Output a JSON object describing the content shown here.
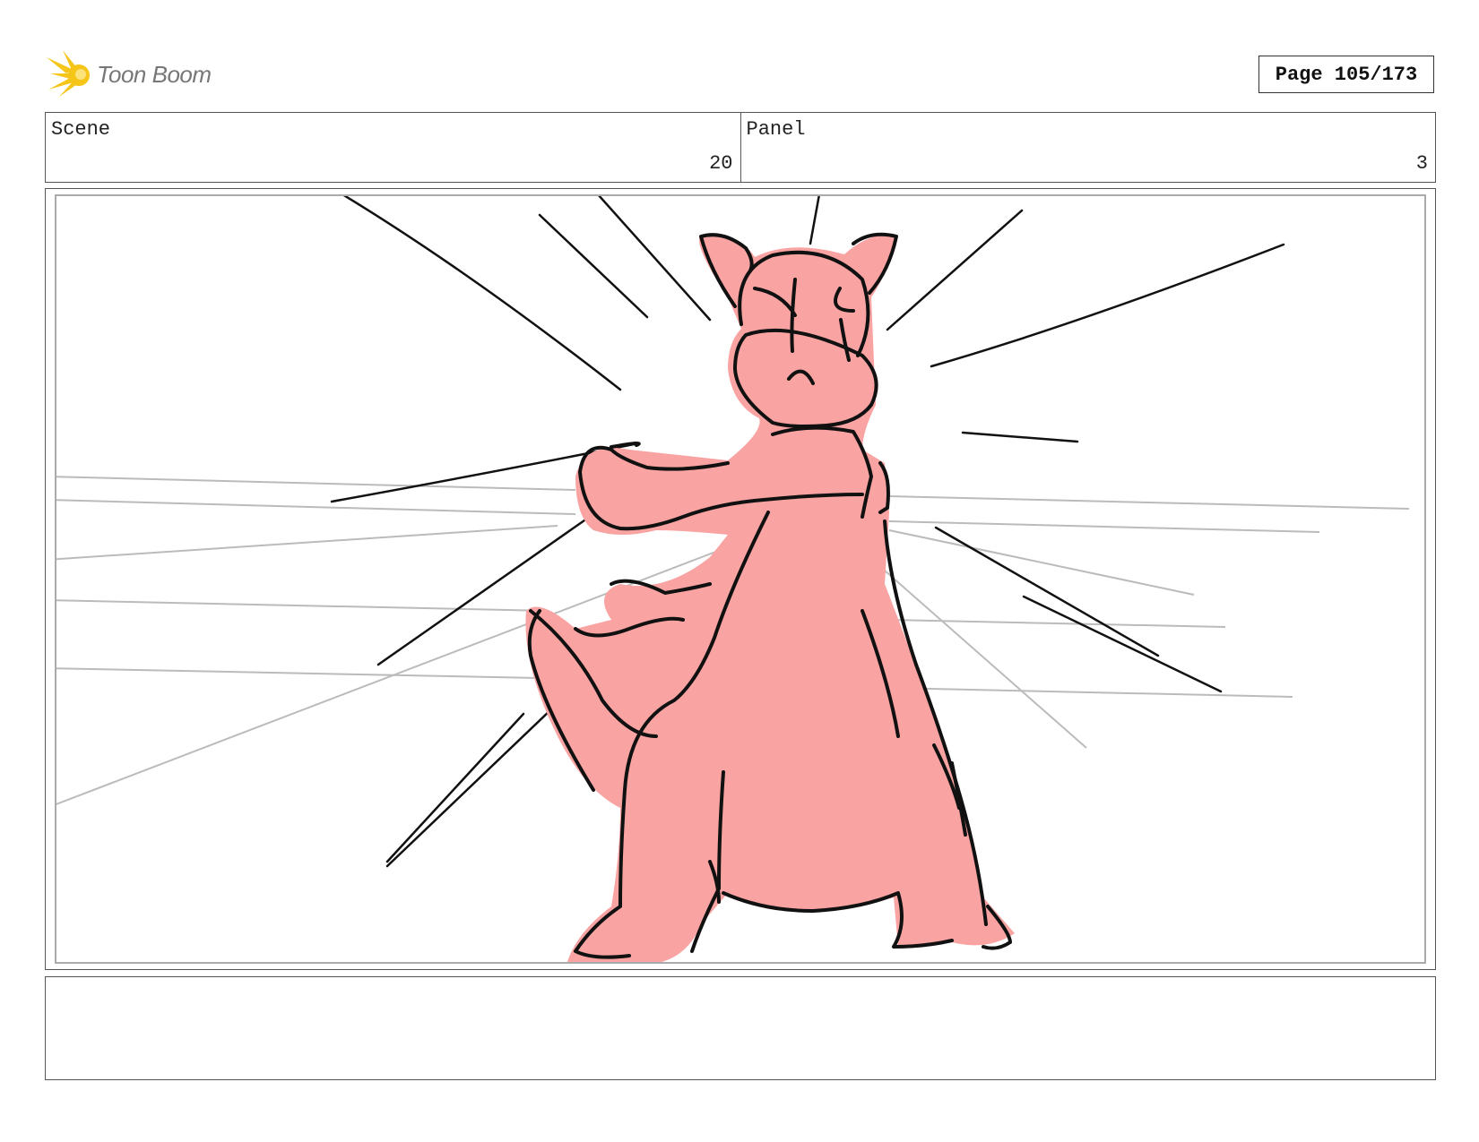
{
  "brand": {
    "name": "Toon Boom",
    "accent_color": "#F5C518",
    "logo_icon": "starburst-icon"
  },
  "page": {
    "label": "Page 105/173"
  },
  "header": {
    "scene_label": "Scene",
    "scene_value": "20",
    "panel_label": "Panel",
    "panel_value": "3"
  },
  "panel": {
    "fill_color": "#F9A3A3",
    "line_color": "#111111",
    "speedline_color": "#BBBBBB"
  },
  "notes": {
    "text": ""
  }
}
